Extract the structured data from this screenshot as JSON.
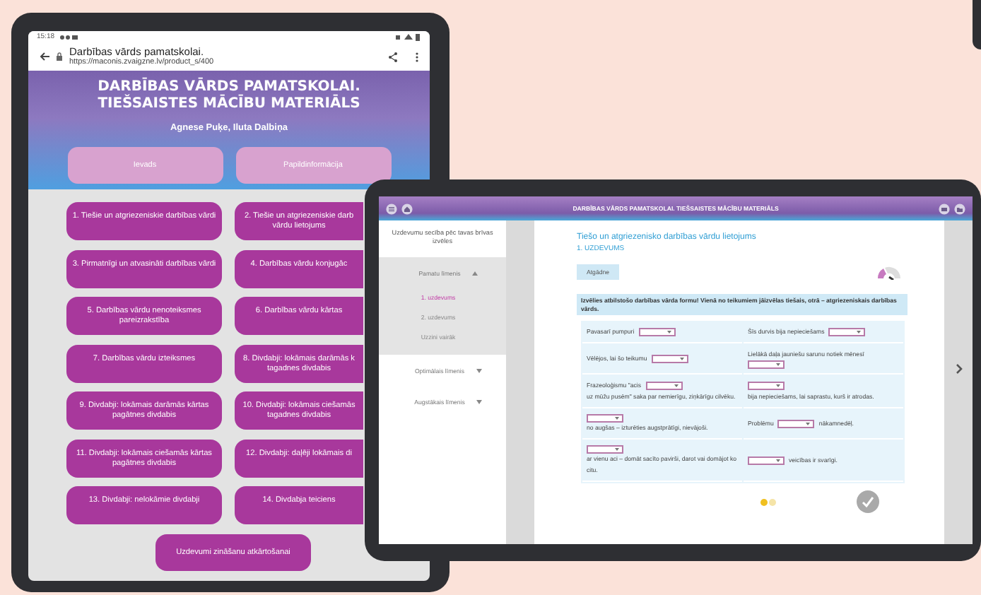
{
  "left_tablet": {
    "status_time": "15:18",
    "page_title": "Darbības vārds pamatskolai.",
    "url": "https://maconis.zvaigzne.lv/product_s/400",
    "heading": [
      "DARBĪBAS VĀRDS PAMATSKOLAI.",
      "TIEŠSAISTES MĀCĪBU MATERIĀLS"
    ],
    "authors": "Agnese Puķe, Iluta Dalbiņa",
    "top_buttons": [
      "Ievads",
      "Papildinformācija"
    ],
    "chapter_buttons": [
      {
        "label": "1. Tiešie un atgriezeniskie darbības vārdi"
      },
      {
        "label": "2. Tiešie un atgriezeniskie darb vārdu lietojums"
      },
      {
        "label": "3. Pirmatnīgi un atvasināti darbības vārdi"
      },
      {
        "label": "4. Darbības vārdu konjugāc"
      },
      {
        "label": "5. Darbības vārdu nenoteiksmes pareizrakstība"
      },
      {
        "label": "6. Darbības vārdu kārtas"
      },
      {
        "label": "7. Darbības vārdu izteiksmes"
      },
      {
        "label": "8. Divdabji: lokāmais darāmās k tagadnes divdabis"
      },
      {
        "label": "9. Divdabji: lokāmais darāmās kārtas pagātnes divdabis"
      },
      {
        "label": "10. Divdabji: lokāmais ciešamās tagadnes divdabis"
      },
      {
        "label": "11. Divdabji: lokāmais ciešamās kārtas pagātnes divdabis"
      },
      {
        "label": "12. Divdabji: daļēji lokāmais di"
      },
      {
        "label": "13. Divdabji: nelokāmie divdabji"
      },
      {
        "label": "14. Divdabja teiciens"
      }
    ],
    "bottom_button": "Uzdevumi zināšanu atkārtošanai"
  },
  "right_tablet": {
    "header_title": "DARBĪBAS VĀRDS PAMATSKOLAI. TIEŠSAISTES MĀCĪBU MATERIĀLS",
    "sidebar": {
      "title": "Uzdevumu secība pēc tavas brīvas izvēles",
      "levels": [
        {
          "label": "Pamatu līmenis",
          "expanded": true,
          "children": [
            {
              "label": "1. uzdevums",
              "selected": true
            },
            {
              "label": "2. uzdevums",
              "selected": false
            },
            {
              "label": "Uzzini vairāk",
              "selected": false
            }
          ]
        },
        {
          "label": "Optimālais līmenis",
          "expanded": false
        },
        {
          "label": "Augstākais līmenis",
          "expanded": false
        }
      ]
    },
    "exercise": {
      "title": "Tiešo un atgriezenisko darbības vārdu lietojums",
      "number": "1. UZDEVUMS",
      "hint_button": "Atgādne",
      "instruction": "Izvēlies atbilstošo darbības vārda formu! Vienā no teikumiem jāizvēlas tiešais, otrā – atgriezeniskais darbības vārds.",
      "rows": [
        [
          [
            {
              "kind": "text",
              "text": "Pavasarī pumpuri"
            },
            {
              "kind": "dropdown"
            }
          ],
          [
            {
              "kind": "text",
              "text": "Šīs durvis bija nepieciešams"
            },
            {
              "kind": "dropdown"
            }
          ]
        ],
        [
          [
            {
              "kind": "text",
              "text": "Vēlējos, lai šo teikumu"
            },
            {
              "kind": "dropdown"
            }
          ],
          [
            {
              "kind": "text",
              "text": "Lielākā daļa jauniešu sarunu notiek mēnesī"
            },
            {
              "kind": "dropdown"
            }
          ]
        ],
        [
          [
            {
              "kind": "text",
              "text": "Frazeoloģismu \"acis"
            },
            {
              "kind": "dropdown"
            },
            {
              "kind": "text",
              "text": "uz mūžu pusēm\" saka par nemierīgu, ziņkārīgu cilvēku."
            }
          ],
          [
            {
              "kind": "dropdown"
            },
            {
              "kind": "text",
              "text": "bija nepieciešams, lai saprastu, kurš ir atrodas."
            }
          ]
        ],
        [
          [
            {
              "kind": "dropdown"
            },
            {
              "kind": "text",
              "text": "no augšas – izturēties augstprātīgi, nievājoši."
            }
          ],
          [
            {
              "kind": "text",
              "text": "Problēmu"
            },
            {
              "kind": "dropdown"
            },
            {
              "kind": "text",
              "text": "nākamnedēļ."
            }
          ]
        ],
        [
          [
            {
              "kind": "dropdown"
            },
            {
              "kind": "text",
              "text": "ar vienu aci – domāt sacīto pavirši, darot vai domājot ko citu."
            }
          ],
          [
            {
              "kind": "dropdown"
            },
            {
              "kind": "text",
              "text": "veicības ir svarīgi."
            }
          ]
        ]
      ]
    },
    "pagination": [
      {
        "selected": true
      },
      {
        "selected": false
      }
    ]
  }
}
